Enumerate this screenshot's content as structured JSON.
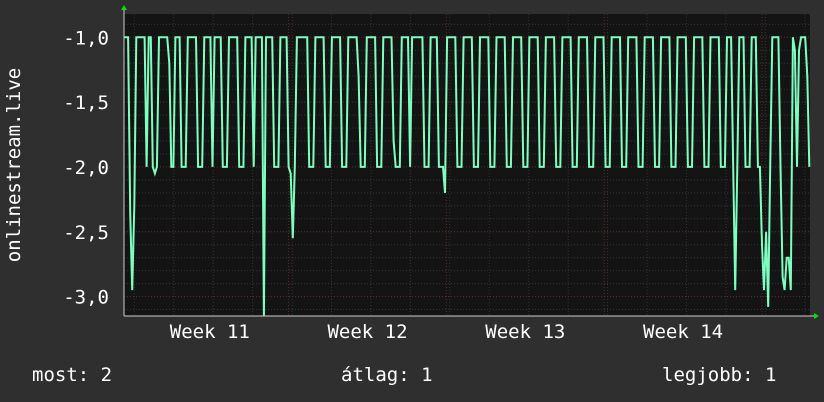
{
  "chart_data": {
    "type": "line",
    "ylabel": "onlinestream.live",
    "ylim": [
      -3.15,
      -0.82
    ],
    "y_ticks": [
      -1.0,
      -1.5,
      -2.0,
      -2.5,
      -3.0
    ],
    "y_tick_labels": [
      "-1,0",
      "-1,5",
      "-2,0",
      "-2,5",
      "-3,0"
    ],
    "xlim": [
      0,
      100
    ],
    "x_ticks": [
      12.5,
      35.5,
      58.5,
      81.5
    ],
    "x_tick_labels": [
      "Week 11",
      "Week 12",
      "Week 13",
      "Week 14"
    ],
    "grid": true,
    "colors": {
      "background": "#2f2f2f",
      "plot_area": "#141414",
      "series": "#7fffbf",
      "grid_minor": "#333333",
      "grid_major": "#5a2a2a",
      "axis_arrow": "#00e000"
    },
    "series": [
      {
        "points": [
          [
            0.0,
            -1.0
          ],
          [
            0.6,
            -1.0
          ],
          [
            0.9,
            -2.35
          ],
          [
            1.2,
            -2.95
          ],
          [
            1.5,
            -2.3
          ],
          [
            1.8,
            -1.0
          ],
          [
            3.0,
            -1.0
          ],
          [
            3.3,
            -2.0
          ],
          [
            3.6,
            -1.0
          ],
          [
            3.9,
            -1.0
          ],
          [
            4.2,
            -2.0
          ],
          [
            4.5,
            -2.05
          ],
          [
            4.8,
            -2.0
          ],
          [
            5.1,
            -1.0
          ],
          [
            6.3,
            -1.0
          ],
          [
            6.6,
            -1.2
          ],
          [
            6.9,
            -2.0
          ],
          [
            7.2,
            -2.0
          ],
          [
            7.5,
            -1.0
          ],
          [
            8.1,
            -1.0
          ],
          [
            8.4,
            -2.0
          ],
          [
            9.0,
            -2.0
          ],
          [
            9.3,
            -1.0
          ],
          [
            10.5,
            -1.0
          ],
          [
            10.8,
            -2.0
          ],
          [
            11.4,
            -2.0
          ],
          [
            11.7,
            -1.0
          ],
          [
            12.3,
            -1.0
          ],
          [
            12.6,
            -1.0
          ],
          [
            12.9,
            -2.0
          ],
          [
            13.2,
            -1.0
          ],
          [
            14.1,
            -1.0
          ],
          [
            14.4,
            -2.0
          ],
          [
            15.0,
            -2.0
          ],
          [
            15.3,
            -1.0
          ],
          [
            16.5,
            -1.0
          ],
          [
            16.8,
            -2.0
          ],
          [
            17.4,
            -2.0
          ],
          [
            17.7,
            -1.0
          ],
          [
            18.6,
            -1.0
          ],
          [
            18.9,
            -2.0
          ],
          [
            19.2,
            -1.0
          ],
          [
            20.1,
            -1.0
          ],
          [
            20.4,
            -3.15
          ],
          [
            20.7,
            -1.0
          ],
          [
            21.6,
            -1.0
          ],
          [
            21.9,
            -2.0
          ],
          [
            22.5,
            -2.0
          ],
          [
            22.8,
            -1.0
          ],
          [
            23.7,
            -1.0
          ],
          [
            24.0,
            -2.0
          ],
          [
            24.3,
            -2.05
          ],
          [
            24.6,
            -2.55
          ],
          [
            24.9,
            -2.0
          ],
          [
            25.2,
            -1.0
          ],
          [
            26.7,
            -1.0
          ],
          [
            27.0,
            -2.0
          ],
          [
            27.6,
            -2.0
          ],
          [
            27.9,
            -1.0
          ],
          [
            29.1,
            -1.0
          ],
          [
            29.4,
            -2.0
          ],
          [
            30.0,
            -2.0
          ],
          [
            30.3,
            -1.0
          ],
          [
            31.5,
            -1.0
          ],
          [
            31.8,
            -2.0
          ],
          [
            32.4,
            -2.0
          ],
          [
            32.7,
            -1.0
          ],
          [
            33.9,
            -1.0
          ],
          [
            34.2,
            -1.3
          ],
          [
            34.5,
            -2.0
          ],
          [
            35.1,
            -2.0
          ],
          [
            35.4,
            -1.0
          ],
          [
            36.6,
            -1.0
          ],
          [
            36.9,
            -2.0
          ],
          [
            37.5,
            -2.0
          ],
          [
            37.8,
            -1.0
          ],
          [
            39.0,
            -1.0
          ],
          [
            39.3,
            -1.8
          ],
          [
            39.6,
            -2.0
          ],
          [
            40.2,
            -2.0
          ],
          [
            40.5,
            -1.0
          ],
          [
            41.4,
            -1.0
          ],
          [
            41.7,
            -2.0
          ],
          [
            42.0,
            -1.0
          ],
          [
            43.5,
            -1.0
          ],
          [
            43.8,
            -2.0
          ],
          [
            44.4,
            -2.0
          ],
          [
            44.7,
            -1.0
          ],
          [
            45.6,
            -1.0
          ],
          [
            45.9,
            -2.0
          ],
          [
            46.5,
            -2.0
          ],
          [
            46.8,
            -2.2
          ],
          [
            47.1,
            -1.0
          ],
          [
            48.3,
            -1.0
          ],
          [
            48.6,
            -2.0
          ],
          [
            49.2,
            -2.0
          ],
          [
            49.5,
            -1.0
          ],
          [
            50.7,
            -1.0
          ],
          [
            51.0,
            -2.0
          ],
          [
            51.6,
            -2.0
          ],
          [
            51.9,
            -1.0
          ],
          [
            53.1,
            -1.0
          ],
          [
            53.4,
            -2.0
          ],
          [
            54.0,
            -2.0
          ],
          [
            54.3,
            -1.0
          ],
          [
            55.5,
            -1.0
          ],
          [
            55.8,
            -2.0
          ],
          [
            56.4,
            -2.0
          ],
          [
            56.7,
            -1.0
          ],
          [
            57.9,
            -1.0
          ],
          [
            58.2,
            -2.0
          ],
          [
            58.8,
            -2.0
          ],
          [
            59.1,
            -1.0
          ],
          [
            60.3,
            -1.0
          ],
          [
            60.6,
            -2.0
          ],
          [
            61.2,
            -2.0
          ],
          [
            61.5,
            -1.0
          ],
          [
            62.7,
            -1.0
          ],
          [
            63.0,
            -2.0
          ],
          [
            63.6,
            -2.0
          ],
          [
            63.9,
            -1.0
          ],
          [
            65.1,
            -1.0
          ],
          [
            65.4,
            -2.0
          ],
          [
            66.0,
            -2.0
          ],
          [
            66.3,
            -1.0
          ],
          [
            67.5,
            -1.0
          ],
          [
            67.8,
            -2.0
          ],
          [
            68.4,
            -2.0
          ],
          [
            68.7,
            -1.0
          ],
          [
            69.9,
            -1.0
          ],
          [
            70.2,
            -2.0
          ],
          [
            70.8,
            -2.0
          ],
          [
            71.1,
            -1.0
          ],
          [
            72.3,
            -1.0
          ],
          [
            72.6,
            -2.0
          ],
          [
            73.2,
            -2.0
          ],
          [
            73.5,
            -1.0
          ],
          [
            74.7,
            -1.0
          ],
          [
            75.0,
            -2.0
          ],
          [
            75.6,
            -2.0
          ],
          [
            75.9,
            -1.0
          ],
          [
            77.1,
            -1.0
          ],
          [
            77.4,
            -2.0
          ],
          [
            78.0,
            -2.0
          ],
          [
            78.3,
            -1.0
          ],
          [
            79.5,
            -1.0
          ],
          [
            79.8,
            -2.0
          ],
          [
            80.4,
            -2.0
          ],
          [
            80.7,
            -1.0
          ],
          [
            81.9,
            -1.0
          ],
          [
            82.2,
            -2.0
          ],
          [
            82.8,
            -2.0
          ],
          [
            83.1,
            -1.0
          ],
          [
            84.3,
            -1.0
          ],
          [
            84.6,
            -2.0
          ],
          [
            85.2,
            -2.0
          ],
          [
            85.5,
            -1.0
          ],
          [
            86.7,
            -1.0
          ],
          [
            87.0,
            -2.0
          ],
          [
            87.6,
            -2.0
          ],
          [
            87.9,
            -1.0
          ],
          [
            88.5,
            -1.0
          ],
          [
            88.8,
            -2.0
          ],
          [
            89.1,
            -2.95
          ],
          [
            89.4,
            -2.0
          ],
          [
            89.7,
            -1.0
          ],
          [
            90.3,
            -1.0
          ],
          [
            90.6,
            -2.0
          ],
          [
            91.2,
            -2.0
          ],
          [
            91.5,
            -1.0
          ],
          [
            92.1,
            -1.0
          ],
          [
            92.4,
            -2.0
          ],
          [
            92.7,
            -2.0
          ],
          [
            93.0,
            -2.6
          ],
          [
            93.3,
            -2.95
          ],
          [
            93.6,
            -2.5
          ],
          [
            93.9,
            -3.08
          ],
          [
            94.2,
            -2.0
          ],
          [
            94.5,
            -1.0
          ],
          [
            95.4,
            -1.0
          ],
          [
            95.7,
            -2.0
          ],
          [
            96.0,
            -2.85
          ],
          [
            96.3,
            -2.95
          ],
          [
            96.6,
            -2.7
          ],
          [
            96.9,
            -2.7
          ],
          [
            97.2,
            -2.95
          ],
          [
            97.5,
            -1.0
          ],
          [
            97.8,
            -1.1
          ],
          [
            98.1,
            -2.0
          ],
          [
            98.4,
            -1.1
          ],
          [
            98.7,
            -1.0
          ],
          [
            99.3,
            -1.0
          ],
          [
            99.6,
            -1.3
          ],
          [
            99.9,
            -2.0
          ]
        ]
      }
    ]
  },
  "legend": {
    "current": "most: 2",
    "average": "átlag: 1",
    "best": "legjobb: 1"
  }
}
